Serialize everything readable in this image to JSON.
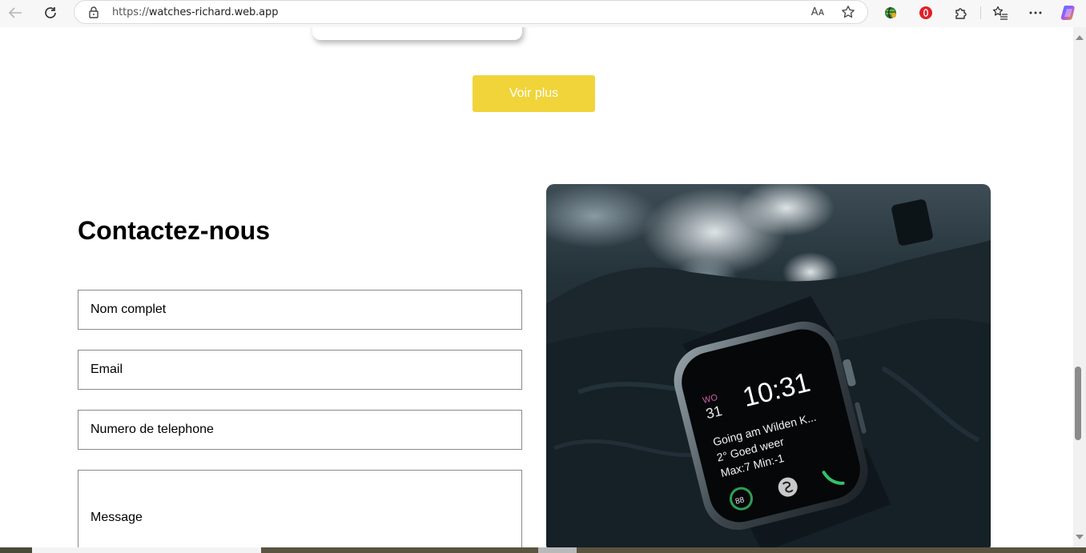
{
  "browser": {
    "url_scheme": "https://",
    "url_host": "watches-richard.web.app",
    "read_aloud_label": "Aᴀ"
  },
  "page": {
    "more_button": "Voir plus",
    "contact": {
      "title": "Contactez-nous",
      "name_placeholder": "Nom complet",
      "email_placeholder": "Email",
      "phone_placeholder": "Numero de telephone",
      "message_placeholder": "Message"
    },
    "watch_face": {
      "day": "WO",
      "date": "31",
      "time": "10:31",
      "line1": "Going am Wilden K...",
      "line2": "2° Goed weer",
      "line3": "Max:7 Min:-1",
      "ring_value": "88"
    }
  },
  "colors": {
    "accent_button": "#f0d43a",
    "field_border": "#8a8a8a"
  },
  "icons": [
    "back-icon",
    "refresh-icon",
    "lock-icon",
    "read-aloud-icon",
    "favorite-star-icon",
    "extension-globe-icon",
    "opera-icon",
    "extensions-puzzle-icon",
    "favorites-list-icon",
    "more-menu-icon",
    "copilot-icon"
  ]
}
